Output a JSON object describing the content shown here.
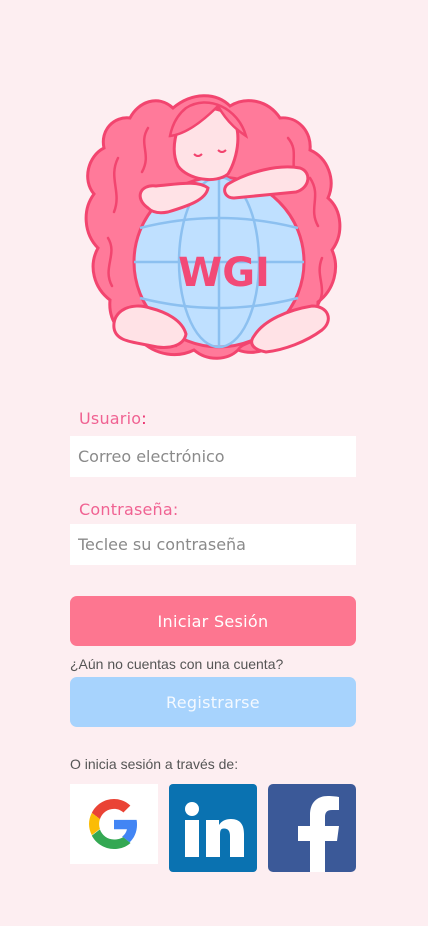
{
  "logo": {
    "text": "WGI"
  },
  "form": {
    "user_label": "Usuario",
    "user_colon": ":",
    "email_placeholder": "Correo electrónico",
    "password_label": "Contraseña:",
    "password_placeholder": "Teclee su contraseña",
    "login_button": "Iniciar Sesión",
    "no_account_text": "¿Aún no cuentas con una cuenta?",
    "register_button": "Registrarse",
    "social_text": "O inicia sesión a través de:"
  },
  "social": [
    {
      "name": "Google",
      "icon": "google-icon",
      "color": "#ffffff"
    },
    {
      "name": "LinkedIn",
      "icon": "linkedin-icon",
      "color": "#0a72b1"
    },
    {
      "name": "Facebook",
      "icon": "facebook-icon",
      "color": "#3b5998"
    }
  ],
  "colors": {
    "background": "#fdeef1",
    "accent_pink": "#fd7690",
    "label_pink": "#f06292",
    "register_blue": "#a7d3fd",
    "globe_blue": "#bfe0ff"
  }
}
